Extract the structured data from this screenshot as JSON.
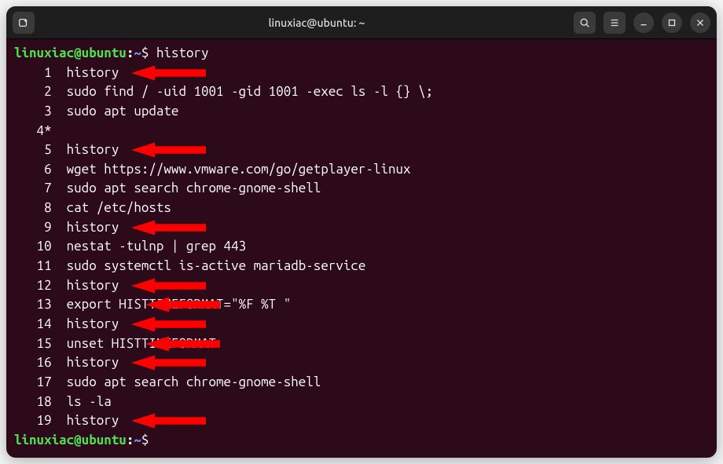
{
  "window": {
    "title": "linuxiac@ubuntu: ~"
  },
  "prompt": {
    "user_host": "linuxiac@ubuntu",
    "separator": ":",
    "path": "~",
    "symbol": "$"
  },
  "typed_command": "history",
  "history": [
    {
      "num": "1",
      "cmd": "history",
      "arrow": true
    },
    {
      "num": "2",
      "cmd": "sudo find / -uid 1001 -gid 1001 -exec ls -l {} \\;",
      "arrow": false
    },
    {
      "num": "3",
      "cmd": "sudo apt update",
      "arrow": false
    },
    {
      "num": "4*",
      "cmd": "",
      "arrow": false,
      "nosep": true
    },
    {
      "num": "5",
      "cmd": "history",
      "arrow": true
    },
    {
      "num": "6",
      "cmd": "wget https://www.vmware.com/go/getplayer-linux",
      "arrow": false
    },
    {
      "num": "7",
      "cmd": "sudo apt search chrome-gnome-shell",
      "arrow": false
    },
    {
      "num": "8",
      "cmd": "cat /etc/hosts",
      "arrow": false
    },
    {
      "num": "9",
      "cmd": "history",
      "arrow": true
    },
    {
      "num": "10",
      "cmd": "nestat -tulnp | grep 443",
      "arrow": false
    },
    {
      "num": "11",
      "cmd": "sudo systemctl is-active mariadb-service",
      "arrow": false
    },
    {
      "num": "12",
      "cmd": "history",
      "arrow": true
    },
    {
      "num": "13",
      "cmd": "export HISTTIMEFORMAT=\"%F %T \"",
      "arrow": true
    },
    {
      "num": "14",
      "cmd": "history",
      "arrow": true
    },
    {
      "num": "15",
      "cmd": "unset HISTTIMEFORMAT",
      "arrow": true
    },
    {
      "num": "16",
      "cmd": "history",
      "arrow": true
    },
    {
      "num": "17",
      "cmd": "sudo apt search chrome-gnome-shell",
      "arrow": false
    },
    {
      "num": "18",
      "cmd": "ls -la",
      "arrow": false
    },
    {
      "num": "19",
      "cmd": "history",
      "arrow": true
    }
  ],
  "arrow_lefts": {
    "1": 149,
    "5": 149,
    "9": 149,
    "12": 149,
    "13": 167,
    "14": 149,
    "15": 167,
    "16": 149,
    "19": 149
  },
  "colors": {
    "prompt_user": "#4fe04f",
    "prompt_path": "#6892ff",
    "terminal_bg": "#2c0a1a",
    "arrow_fill": "#ff0000",
    "text": "#ffffff"
  }
}
